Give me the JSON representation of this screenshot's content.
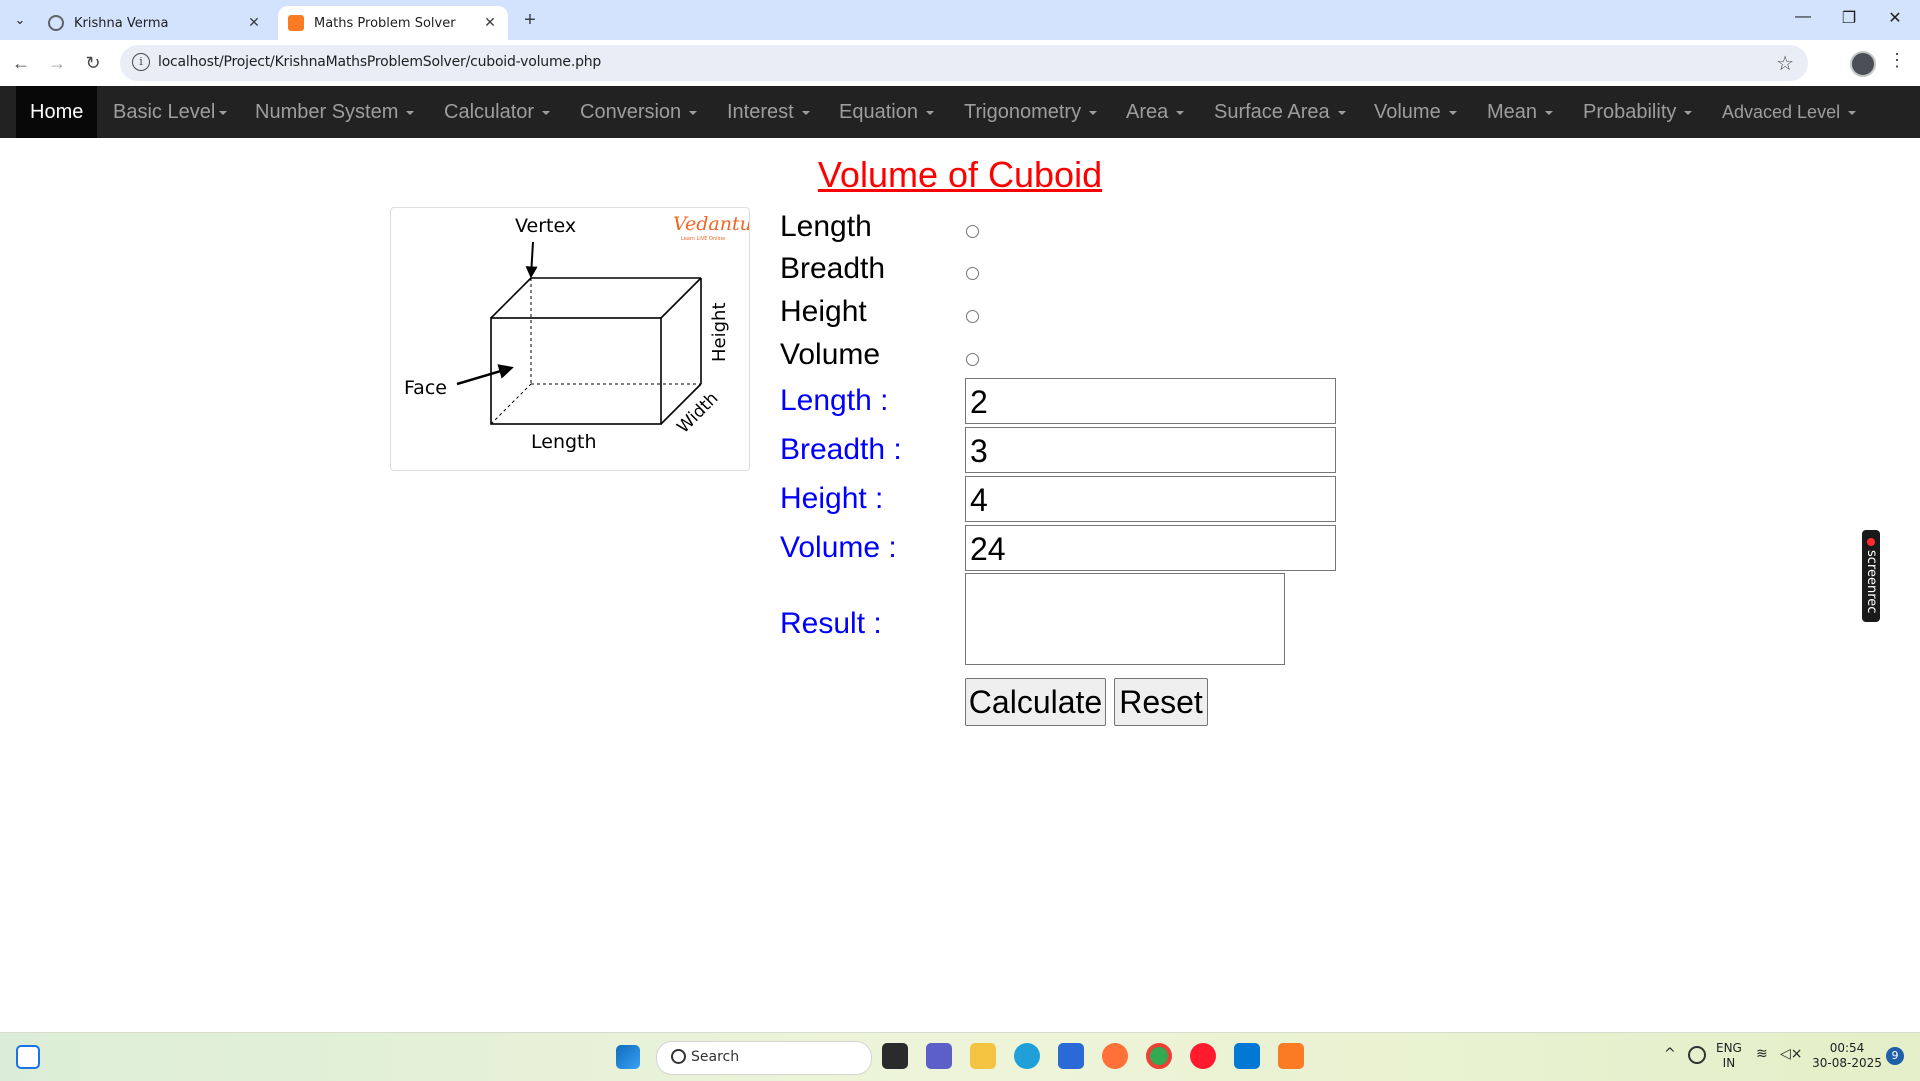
{
  "browser": {
    "tabs": [
      {
        "title": "Krishna Verma",
        "active": false
      },
      {
        "title": "Maths Problem Solver",
        "active": true
      }
    ],
    "url": "localhost/Project/KrishnaMathsProblemSolver/cuboid-volume.php"
  },
  "navbar": {
    "items": [
      {
        "label": "Home"
      },
      {
        "label": "Basic Level"
      },
      {
        "label": "Number System"
      },
      {
        "label": "Calculator"
      },
      {
        "label": "Conversion"
      },
      {
        "label": "Interest"
      },
      {
        "label": "Equation"
      },
      {
        "label": "Trigonometry"
      },
      {
        "label": "Area"
      },
      {
        "label": "Surface Area"
      },
      {
        "label": "Volume"
      },
      {
        "label": "Mean"
      },
      {
        "label": "Probability"
      },
      {
        "label": "Advaced Level"
      }
    ]
  },
  "page": {
    "title": "Volume of Cuboid",
    "figure": {
      "brand": "Vedantu",
      "brand_tagline": "Learn LIVE Online",
      "labels": {
        "vertex": "Vertex",
        "face": "Face",
        "length": "Length",
        "height": "Height",
        "width": "Width"
      }
    },
    "radio_options": [
      {
        "label": "Length"
      },
      {
        "label": "Breadth"
      },
      {
        "label": "Height"
      },
      {
        "label": "Volume"
      }
    ],
    "fields": [
      {
        "label": "Length :",
        "value": "2"
      },
      {
        "label": "Breadth :",
        "value": "3"
      },
      {
        "label": "Height :",
        "value": "4"
      },
      {
        "label": "Volume :",
        "value": "24"
      }
    ],
    "result_label": "Result :",
    "result_value": "",
    "buttons": {
      "calculate": "Calculate",
      "reset": "Reset"
    }
  },
  "overlay": {
    "screenrec": "screenrec"
  },
  "taskbar": {
    "search_placeholder": "Search",
    "lang_line1": "ENG",
    "lang_line2": "IN",
    "time": "00:54",
    "date": "30-08-2025",
    "notification_count": "9"
  }
}
